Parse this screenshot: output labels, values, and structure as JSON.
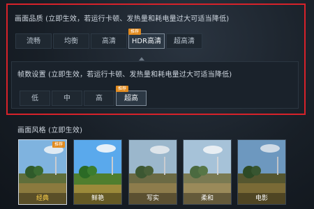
{
  "graphics_quality": {
    "title": "画面品质 (立即生效，若运行卡顿、发热量和耗电量过大可适当降低)",
    "options": [
      "流畅",
      "均衡",
      "高清",
      "HDR高清",
      "超高清"
    ],
    "selected": "HDR高清",
    "badge": "推荐"
  },
  "frame_rate": {
    "title": "帧数设置 (立即生效，若运行卡顿、发热量和耗电量过大可适当降低)",
    "options": [
      "低",
      "中",
      "高",
      "超高"
    ],
    "selected": "超高",
    "badge": "推荐"
  },
  "graphics_style": {
    "title": "画面风格 (立即生效)",
    "options": [
      "经典",
      "鲜艳",
      "写实",
      "柔和",
      "电影"
    ],
    "selected": "经典",
    "badge": "推荐"
  },
  "colors": {
    "highlight_frame": "#d8222a",
    "badge": "#e28b1f",
    "selected_style_label": "#ffd24a"
  }
}
